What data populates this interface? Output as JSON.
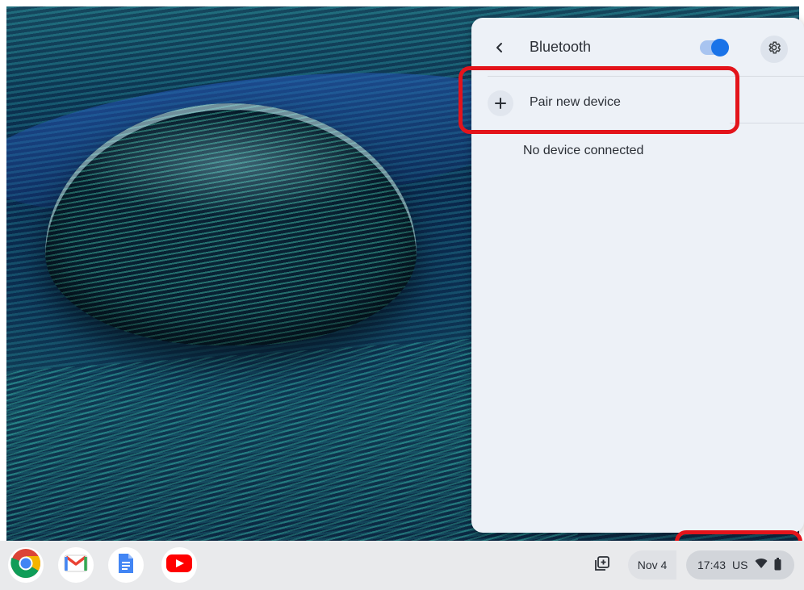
{
  "bluetooth_panel": {
    "title": "Bluetooth",
    "toggle_state": "on",
    "pair_new_device_label": "Pair new device",
    "no_device_label": "No device connected",
    "accent_color": "#1a73e8"
  },
  "shelf": {
    "apps": [
      {
        "name": "Chrome",
        "icon": "chrome-icon"
      },
      {
        "name": "Gmail",
        "icon": "gmail-icon"
      },
      {
        "name": "Docs",
        "icon": "docs-icon"
      },
      {
        "name": "YouTube",
        "icon": "youtube-icon"
      }
    ],
    "date": "Nov 4",
    "time": "17:43",
    "input_method": "US"
  },
  "highlight_color": "#e3141b"
}
